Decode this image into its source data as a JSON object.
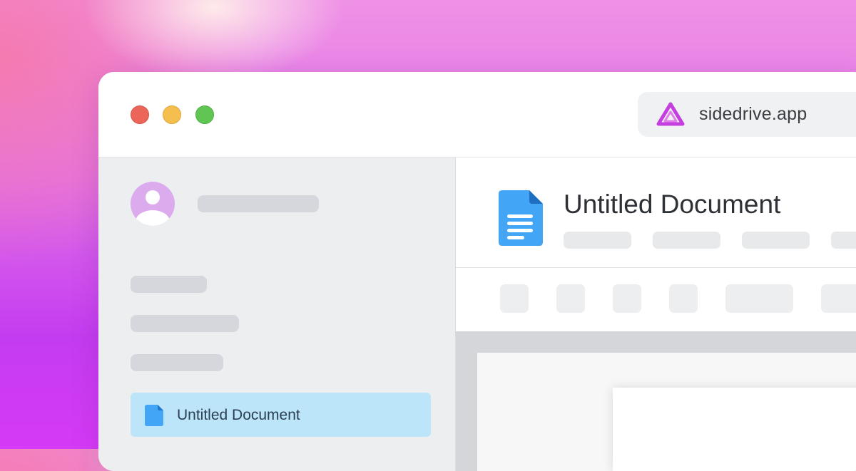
{
  "browser": {
    "url": "sidedrive.app",
    "logo_icon": "sidedrive-logo-icon",
    "traffic_lights": [
      "close",
      "minimize",
      "maximize"
    ]
  },
  "sidebar": {
    "active_item": {
      "label": "Untitled Document",
      "icon": "document-icon"
    }
  },
  "document": {
    "title": "Untitled Document",
    "icon": "google-docs-icon"
  },
  "colors": {
    "accent": "#42a5f5",
    "active_item_bg": "#bde5fa",
    "logo": "#c53edf"
  }
}
